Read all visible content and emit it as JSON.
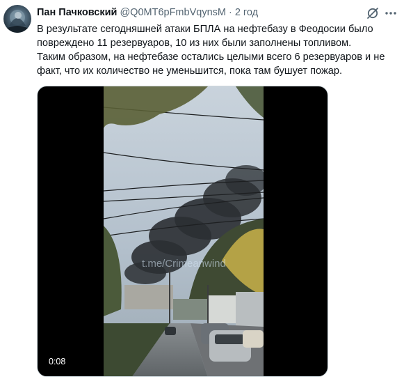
{
  "tweet": {
    "author_name": "Пан Пачковский",
    "author_handle": "@Q0MT6pFmbVqynsM",
    "separator": "·",
    "timestamp": "2 год",
    "text": "В результате сегодняшней атаки БПЛА на нефтебазу в Феодосии было\nповреждено 11 резервуаров, 10 из них были заполнены топливом.\nТаким образом, на нефтебазе остались целыми всего 6 резервуаров и не\nфакт, что их количество не уменьшится, пока там бушует пожар."
  },
  "media": {
    "duration": "0:08",
    "watermark": "t.me/Crimeanwind"
  },
  "icons": {
    "grok": "grok-icon",
    "more": "more-icon",
    "avatar": "avatar"
  },
  "colors": {
    "text": "#0f1419",
    "secondary": "#536471",
    "media_border": "#cfd9de"
  }
}
